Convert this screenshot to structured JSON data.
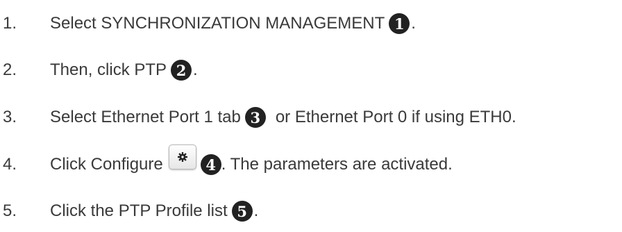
{
  "steps": [
    {
      "number": "1.",
      "text_before": "Select SYNCHRONIZATION MANAGEMENT",
      "callout": "1",
      "text_after": "."
    },
    {
      "number": "2.",
      "text_before": "Then, click PTP",
      "callout": "2",
      "text_after": "."
    },
    {
      "number": "3.",
      "text_before": "Select Ethernet Port 1 tab",
      "callout": "3",
      "text_after": "or Ethernet Port 0 if using ETH0."
    },
    {
      "number": "4.",
      "text_before": "Click Configure",
      "button_icon": "gear-icon",
      "callout": "4",
      "text_after": ". The parameters are activated."
    },
    {
      "number": "5.",
      "text_before": "Click the PTP Profile list",
      "callout": "5",
      "text_after": "."
    }
  ]
}
